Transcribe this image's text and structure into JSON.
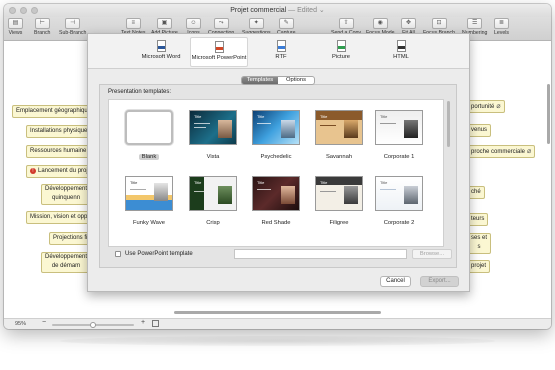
{
  "window": {
    "title": "Projet commercial",
    "edited": "— Edited ⌄"
  },
  "toolbar": {
    "views": "Views",
    "branch": "Branch",
    "sub_branch": "Sub-Branch",
    "text_notes": "Text Notes",
    "add_picture": "Add Picture",
    "icons": "Icons",
    "connection": "Connection",
    "suggestions": "Suggestions",
    "capture": "Capture",
    "send_copy": "Send a Copy",
    "focus_mode": "Focus Mode",
    "fit_all": "Fit All",
    "focus_branch": "Focus Branch",
    "numbering": "Numbering",
    "levels": "Levels"
  },
  "mindmap": {
    "left_topics": [
      "Emplacement géographique",
      "Installations physique",
      "Ressources humaine",
      "Lancement du proj",
      "Développement",
      "quinquenn",
      "Mission, vision et opp",
      "Projections fir",
      "Développement",
      "de démam"
    ],
    "right_topics": [
      "portunité",
      "venus",
      "proche commerciale",
      "ché",
      "teurs",
      "ses et",
      "s",
      "projet"
    ]
  },
  "export_sheet": {
    "formats": [
      {
        "label": "Microsoft Word",
        "color": "#2b579a"
      },
      {
        "label": "Microsoft PowerPoint",
        "color": "#d24726"
      },
      {
        "label": "RTF",
        "color": "#3b7dd8"
      },
      {
        "label": "Picture",
        "color": "#2e9e4f"
      },
      {
        "label": "HTML",
        "color": "#333333"
      }
    ],
    "tabs": {
      "templates": "Templates",
      "options": "Options"
    },
    "section_label": "Presentation templates:",
    "templates": [
      "Blank",
      "Vista",
      "Psychedelic",
      "Savannah",
      "Corporate 1",
      "Funky Wave",
      "Crisp",
      "Red Shade",
      "Filigree",
      "Corporate 2"
    ],
    "thumb_title": "Title",
    "use_template_label": "Use PowerPoint template",
    "browse_label": "Browse...",
    "cancel_label": "Cancel",
    "export_label": "Export..."
  },
  "status": {
    "zoom": "95%",
    "zoom_level": 0.5
  }
}
